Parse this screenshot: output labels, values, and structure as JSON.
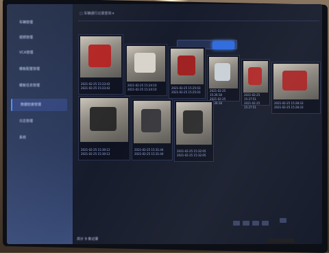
{
  "sidebar": {
    "items": [
      {
        "label": "车辆管理"
      },
      {
        "label": "视频管理"
      },
      {
        "label": "VCA管理"
      },
      {
        "label": "模板配置管理"
      },
      {
        "label": "模板任务管理"
      },
      {
        "label": "数据检索管理"
      },
      {
        "label": "日志管理"
      },
      {
        "label": "系统"
      }
    ],
    "active_index": 5
  },
  "header": {
    "title": "□ 车辆通行记录查询  ▾"
  },
  "grid": {
    "row1": [
      {
        "caption_top": "2021-02-25 15:23:42",
        "caption_bottom": "2021-02-25 15:23:42",
        "car_color": "#b32424"
      },
      {
        "caption_top": "2021-02-25 15:24:10",
        "caption_bottom": "2021-02-25 15:24:10",
        "car_color": "#d8d4cc"
      },
      {
        "caption_top": "2021-02-25 15:25:03",
        "caption_bottom": "2021-02-25 15:25:03",
        "car_color": "#a02020"
      },
      {
        "caption_top": "2021-02-25 15:26:18",
        "caption_bottom": "2021-02-25 15:26:18",
        "car_color": "#c9d0d6"
      },
      {
        "caption_top": "2021-02-25 15:27:51",
        "caption_bottom": "2021-02-25 15:27:51",
        "car_color": "#b12a2a"
      },
      {
        "caption_top": "2021-02-25 15:28:33",
        "caption_bottom": "2021-02-25 15:28:33",
        "car_color": "#a82828"
      }
    ],
    "row2": [
      {
        "caption_top": "2021-02-25 15:30:12",
        "caption_bottom": "2021-02-25 15:30:12",
        "car_color": "#2a2a2a"
      },
      {
        "caption_top": "2021-02-25 15:31:44",
        "caption_bottom": "2021-02-25 15:31:44",
        "car_color": "#3a3a3e"
      },
      {
        "caption_top": "2021-02-25 15:32:05",
        "caption_bottom": "2021-02-25 15:32:05",
        "car_color": "#2e2e2e"
      }
    ]
  },
  "footer": {
    "text": "共计 9 条记录"
  }
}
